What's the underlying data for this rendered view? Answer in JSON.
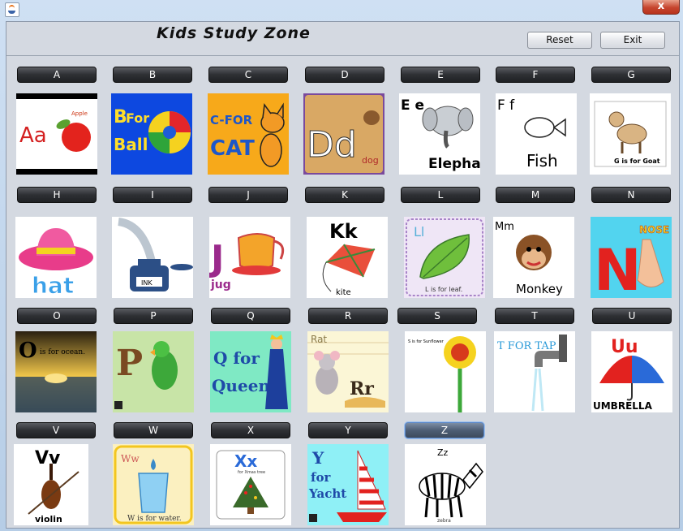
{
  "window": {
    "title_icon": "java-icon",
    "close_label": "x"
  },
  "app": {
    "title": "Kids Study Zone",
    "reset_label": "Reset",
    "exit_label": "Exit"
  },
  "letters": [
    "A",
    "B",
    "C",
    "D",
    "E",
    "F",
    "G",
    "H",
    "I",
    "J",
    "K",
    "L",
    "M",
    "N",
    "O",
    "P",
    "Q",
    "R",
    "S",
    "T",
    "U",
    "V",
    "W",
    "X",
    "Y",
    "Z"
  ],
  "active_letter": "Z",
  "tiles": {
    "A": {
      "big": "Aa",
      "word": "Apple"
    },
    "B": {
      "big": "B",
      "line1": "For",
      "line2": "Ball"
    },
    "C": {
      "line1": "C-FOR",
      "line2": "CAT"
    },
    "D": {
      "big": "Dd",
      "word": "dog"
    },
    "E": {
      "big": "E e",
      "word": "Elephant"
    },
    "F": {
      "big": "F f",
      "word": "Fish"
    },
    "G": {
      "caption": "G is for Goat"
    },
    "H": {
      "word": "hat"
    },
    "I": {
      "word": "INK"
    },
    "J": {
      "big": "J",
      "word": "jug"
    },
    "K": {
      "big": "Kk",
      "word": "kite"
    },
    "L": {
      "big": "Ll",
      "caption": "L is for leaf."
    },
    "M": {
      "big": "Mm",
      "word": "Monkey"
    },
    "N": {
      "big": "N",
      "word": "NOSE"
    },
    "O": {
      "big": "O",
      "caption": "is for ocean."
    },
    "P": {
      "big": "P"
    },
    "Q": {
      "line1": "Q for",
      "line2": "Queen"
    },
    "R": {
      "word": "Rat",
      "big": "Rr"
    },
    "S": {
      "caption": "S is for Sunflower"
    },
    "T": {
      "caption": "T FOR TAP"
    },
    "U": {
      "big": "Uu",
      "word": "UMBRELLA"
    },
    "V": {
      "big": "Vv",
      "word": "violin"
    },
    "W": {
      "big": "Ww",
      "caption": "W is for water."
    },
    "X": {
      "big": "Xx",
      "caption": "for Xmas tree"
    },
    "Y": {
      "line1": "Y",
      "line2": "for",
      "line3": "Yacht"
    },
    "Z": {
      "big": "Zz",
      "word": "zebra"
    }
  }
}
